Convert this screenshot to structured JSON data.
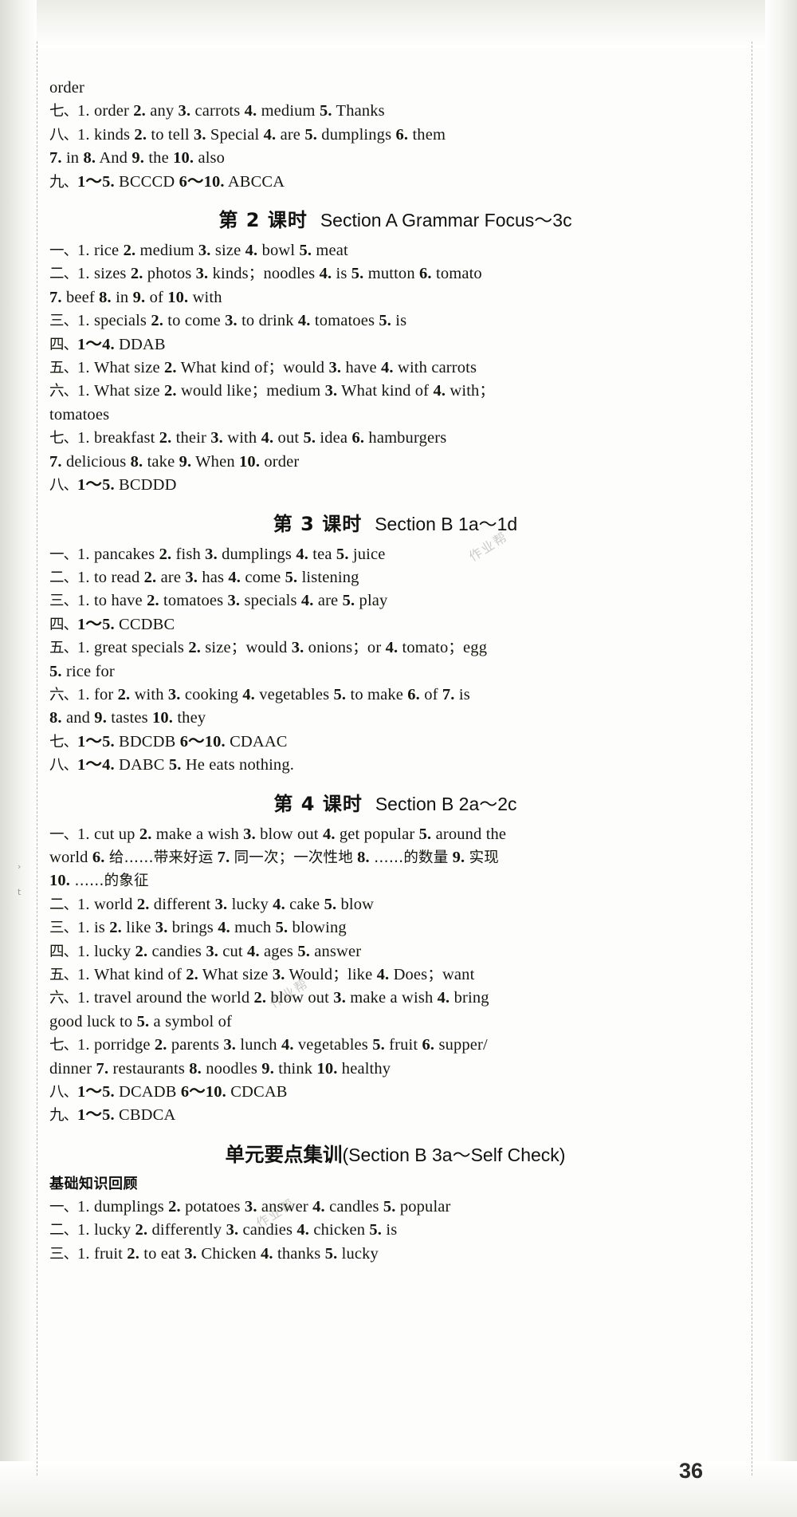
{
  "page": {
    "number": "36",
    "watermarks": [
      "作业帮",
      "作业帮",
      "作业帮"
    ]
  },
  "blocks": [
    {
      "type": "line",
      "name": "continuation-order",
      "text": "order"
    },
    {
      "type": "line",
      "name": "answer-line-7",
      "text": "七、1. order  2. any  3. carrots  4. medium  5. Thanks"
    },
    {
      "type": "line",
      "name": "answer-line-8",
      "text": "八、1. kinds  2. to tell  3. Special  4. are  5. dumplings  6. them"
    },
    {
      "type": "line",
      "name": "answer-line-8-cont",
      "text": "7. in  8. And  9. the  10. also"
    },
    {
      "type": "line",
      "name": "answer-line-9",
      "text": "九、1～5. BCCCD  6～10. ABCCA"
    },
    {
      "type": "period",
      "name": "period-heading-2",
      "cn": "第 2 课时",
      "en": "Section A Grammar Focus～3c"
    },
    {
      "type": "line",
      "name": "p2-answer-1",
      "text": "一、1. rice  2. medium  3. size  4. bowl  5. meat"
    },
    {
      "type": "line",
      "name": "p2-answer-2",
      "text": "二、1. sizes  2. photos  3. kinds；noodles  4. is  5. mutton  6. tomato"
    },
    {
      "type": "line",
      "name": "p2-answer-2-cont",
      "text": "7. beef  8. in  9. of  10. with"
    },
    {
      "type": "line",
      "name": "p2-answer-3",
      "text": "三、1. specials  2. to come  3. to drink  4. tomatoes  5. is"
    },
    {
      "type": "line",
      "name": "p2-answer-4",
      "text": "四、1～4. DDAB"
    },
    {
      "type": "line",
      "name": "p2-answer-5",
      "text": "五、1. What size  2. What kind of；would  3. have  4. with carrots"
    },
    {
      "type": "line",
      "name": "p2-answer-6",
      "text": "六、1. What size  2. would like；medium  3. What kind of  4. with；"
    },
    {
      "type": "line",
      "name": "p2-answer-6-cont",
      "text": "tomatoes"
    },
    {
      "type": "line",
      "name": "p2-answer-7",
      "text": "七、1. breakfast  2. their  3. with  4. out  5. idea  6. hamburgers"
    },
    {
      "type": "line",
      "name": "p2-answer-7-cont",
      "text": "7. delicious  8. take  9. When  10. order"
    },
    {
      "type": "line",
      "name": "p2-answer-8",
      "text": "八、1～5. BCDDD"
    },
    {
      "type": "period",
      "name": "period-heading-3",
      "cn": "第 3 课时",
      "en": "Section B 1a～1d"
    },
    {
      "type": "line",
      "name": "p3-answer-1",
      "text": "一、1. pancakes  2. fish  3. dumplings  4. tea  5. juice"
    },
    {
      "type": "line",
      "name": "p3-answer-2",
      "text": "二、1. to read  2. are  3. has  4. come  5. listening"
    },
    {
      "type": "line",
      "name": "p3-answer-3",
      "text": "三、1. to have  2. tomatoes  3. specials  4. are  5. play"
    },
    {
      "type": "line",
      "name": "p3-answer-4",
      "text": "四、1～5. CCDBC"
    },
    {
      "type": "line",
      "name": "p3-answer-5",
      "text": "五、1. great specials  2. size；would  3. onions；or  4. tomato；egg"
    },
    {
      "type": "line",
      "name": "p3-answer-5-cont",
      "text": "5. rice for"
    },
    {
      "type": "line",
      "name": "p3-answer-6",
      "text": "六、1. for  2. with  3. cooking  4. vegetables  5. to make  6. of  7. is"
    },
    {
      "type": "line",
      "name": "p3-answer-6-cont",
      "text": "8. and  9. tastes  10. they"
    },
    {
      "type": "line",
      "name": "p3-answer-7",
      "text": "七、1～5. BDCDB  6～10. CDAAC"
    },
    {
      "type": "line",
      "name": "p3-answer-8",
      "text": "八、1～4. DABC  5. He eats nothing."
    },
    {
      "type": "period",
      "name": "period-heading-4",
      "cn": "第 4 课时",
      "en": "Section B 2a～2c"
    },
    {
      "type": "line",
      "name": "p4-answer-1",
      "text": "一、1. cut up  2. make a wish  3. blow out  4. get popular  5. around the"
    },
    {
      "type": "line",
      "name": "p4-answer-1-cont",
      "text": "world  6. 给……带来好运  7. 同一次；一次性地  8. ……的数量  9. 实现"
    },
    {
      "type": "line",
      "name": "p4-answer-1-cont2",
      "text": "10. ……的象征"
    },
    {
      "type": "line",
      "name": "p4-answer-2",
      "text": "二、1. world  2. different  3. lucky  4. cake  5. blow"
    },
    {
      "type": "line",
      "name": "p4-answer-3",
      "text": "三、1. is  2. like  3. brings  4. much  5. blowing"
    },
    {
      "type": "line",
      "name": "p4-answer-4",
      "text": "四、1. lucky  2. candies  3. cut  4. ages  5. answer"
    },
    {
      "type": "line",
      "name": "p4-answer-5",
      "text": "五、1. What kind of  2. What size  3. Would；like  4. Does；want"
    },
    {
      "type": "line",
      "name": "p4-answer-6",
      "text": "六、1. travel around the world  2. blow out  3. make a wish  4. bring"
    },
    {
      "type": "line",
      "name": "p4-answer-6-cont",
      "text": "good luck to  5. a symbol of"
    },
    {
      "type": "line",
      "name": "p4-answer-7",
      "text": "七、1. porridge  2. parents  3. lunch  4. vegetables  5. fruit  6. supper/"
    },
    {
      "type": "line",
      "name": "p4-answer-7-cont",
      "text": "dinner  7. restaurants  8. noodles  9. think  10. healthy"
    },
    {
      "type": "line",
      "name": "p4-answer-8",
      "text": "八、1～5. DCADB  6～10. CDCAB"
    },
    {
      "type": "line",
      "name": "p4-answer-9",
      "text": "九、1～5. CBDCA"
    },
    {
      "type": "unit-head",
      "name": "unit-summary-heading",
      "cn": "单元要点集训",
      "en": "(Section B 3a～Self Check)"
    },
    {
      "type": "sub-head",
      "name": "basics-review-heading",
      "text": "基础知识回顾"
    },
    {
      "type": "line",
      "name": "unit-answer-1",
      "text": "一、1. dumplings  2. potatoes  3. answer  4. candles  5. popular"
    },
    {
      "type": "line",
      "name": "unit-answer-2",
      "text": "二、1. lucky  2. differently  3. candies  4. chicken  5. is"
    },
    {
      "type": "line",
      "name": "unit-answer-3",
      "text": "三、1. fruit  2. to eat  3. Chicken  4. thanks  5. lucky"
    }
  ]
}
